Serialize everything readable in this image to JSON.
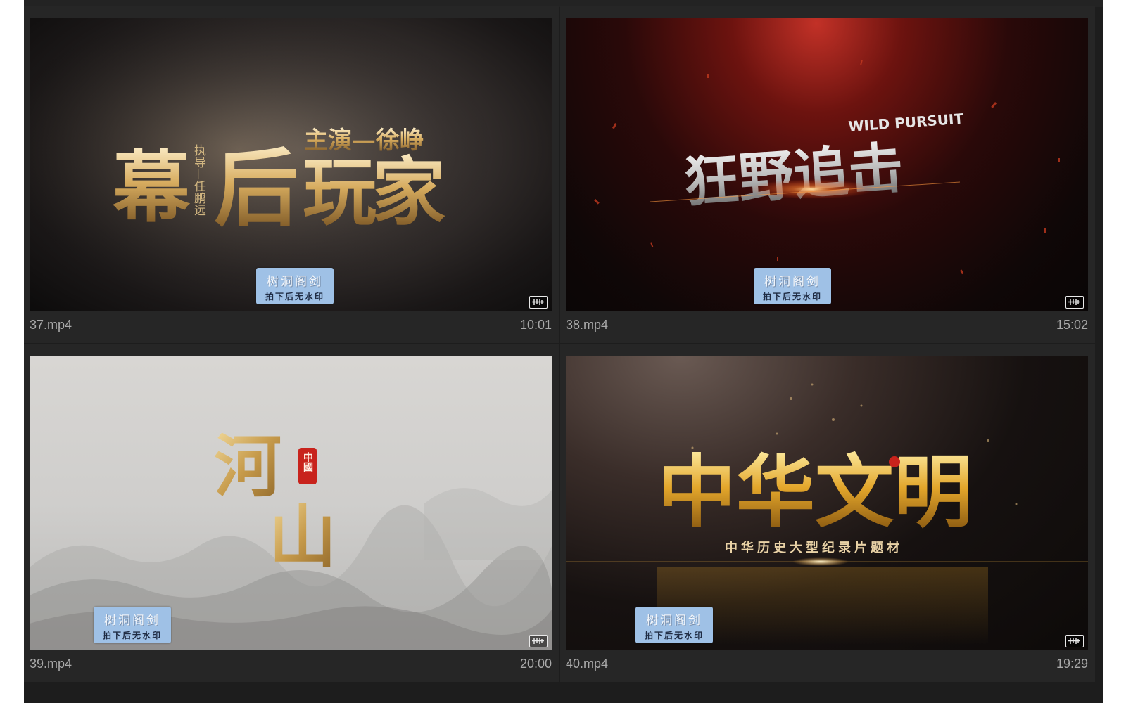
{
  "tiles": [
    {
      "filename": "37.mp4",
      "duration": "10:01",
      "title": "幕后玩家",
      "subtitle_right": "主演—徐峥",
      "subtitle_left": "执导—任鹏远",
      "watermark_line1": "树洞阁剑",
      "watermark_line2": "拍下后无水印"
    },
    {
      "filename": "38.mp4",
      "duration": "15:02",
      "title": "狂野追击",
      "subtitle_right": "WILD PURSUIT",
      "watermark_line1": "树洞阁剑",
      "watermark_line2": "拍下后无水印"
    },
    {
      "filename": "39.mp4",
      "duration": "20:00",
      "title_top": "河",
      "title_bottom": "山",
      "seal": "中國",
      "watermark_line1": "树洞阁剑",
      "watermark_line2": "拍下后无水印"
    },
    {
      "filename": "40.mp4",
      "duration": "19:29",
      "title": "中华文明",
      "subtitle": "中华历史大型纪录片题材",
      "watermark_line1": "树洞阁剑",
      "watermark_line2": "拍下后无水印"
    }
  ],
  "icons": {
    "audio_badge": "audio-waveform-icon"
  },
  "colors": {
    "panel_bg": "#1d1d1d",
    "tile_bg": "#262626",
    "meta_text": "#a9a9a9",
    "watermark_bg": "#9fc1e6",
    "gold": "#d8b26a"
  }
}
